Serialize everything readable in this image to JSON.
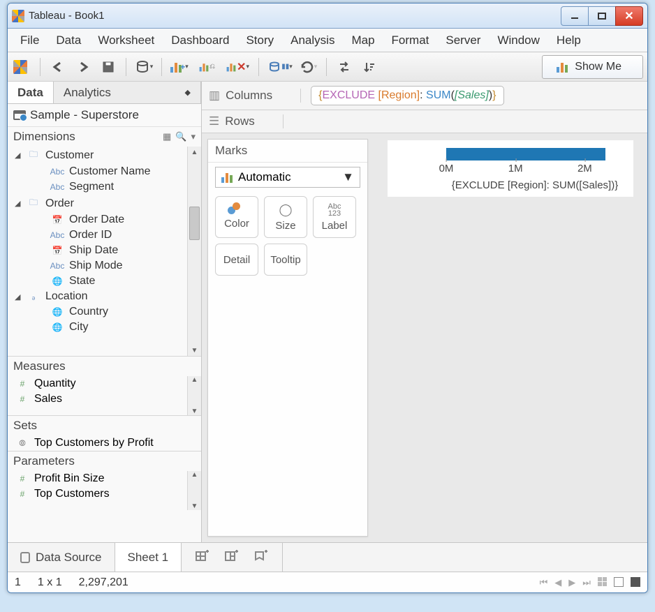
{
  "window": {
    "title": "Tableau - Book1"
  },
  "menu": [
    "File",
    "Data",
    "Worksheet",
    "Dashboard",
    "Story",
    "Analysis",
    "Map",
    "Format",
    "Server",
    "Window",
    "Help"
  ],
  "toolbar": {
    "showme": "Show Me"
  },
  "left": {
    "tabs": {
      "data": "Data",
      "analytics": "Analytics"
    },
    "datasource": "Sample - Superstore",
    "dimensions_hdr": "Dimensions",
    "dimensions": {
      "customer": {
        "label": "Customer",
        "name": "Customer Name",
        "segment": "Segment"
      },
      "order": {
        "label": "Order",
        "date": "Order Date",
        "id": "Order ID",
        "shipdate": "Ship Date",
        "shipmode": "Ship Mode",
        "state": "State"
      },
      "location": {
        "label": "Location",
        "country": "Country",
        "city": "City"
      }
    },
    "measures_hdr": "Measures",
    "measures": {
      "quantity": "Quantity",
      "sales": "Sales"
    },
    "sets_hdr": "Sets",
    "sets": {
      "topcust": "Top Customers by Profit"
    },
    "parameters_hdr": "Parameters",
    "parameters": {
      "profitbin": "Profit Bin Size",
      "topcust": "Top Customers"
    }
  },
  "shelves": {
    "columns_label": "Columns",
    "rows_label": "Rows",
    "columns_pill": {
      "open": "{",
      "kw": "EXCLUDE ",
      "dim": "[Region]",
      "colon": ": ",
      "agg": "SUM",
      "po": "(",
      "meas": "[Sales]",
      "pc": ")",
      "close": "}"
    }
  },
  "marks": {
    "title": "Marks",
    "type": "Automatic",
    "color": "Color",
    "size": "Size",
    "label": "Label",
    "detail": "Detail",
    "tooltip": "Tooltip",
    "label_icon": "Abc\n123"
  },
  "axis": {
    "ticks": [
      "0M",
      "1M",
      "2M"
    ],
    "title": "{EXCLUDE [Region]: SUM([Sales])}"
  },
  "bottom": {
    "datasource": "Data Source",
    "sheet": "Sheet 1"
  },
  "status": {
    "marks": "1",
    "dims": "1 x 1",
    "sum": "2,297,201"
  },
  "chart_data": {
    "type": "bar",
    "orientation": "horizontal",
    "categories": [
      ""
    ],
    "values": [
      2297201
    ],
    "title": "",
    "xlabel": "{EXCLUDE [Region]: SUM([Sales])}",
    "ylabel": "",
    "xlim": [
      0,
      2500000
    ],
    "ticks": [
      0,
      1000000,
      2000000
    ],
    "bar_color": "#1f77b4"
  }
}
